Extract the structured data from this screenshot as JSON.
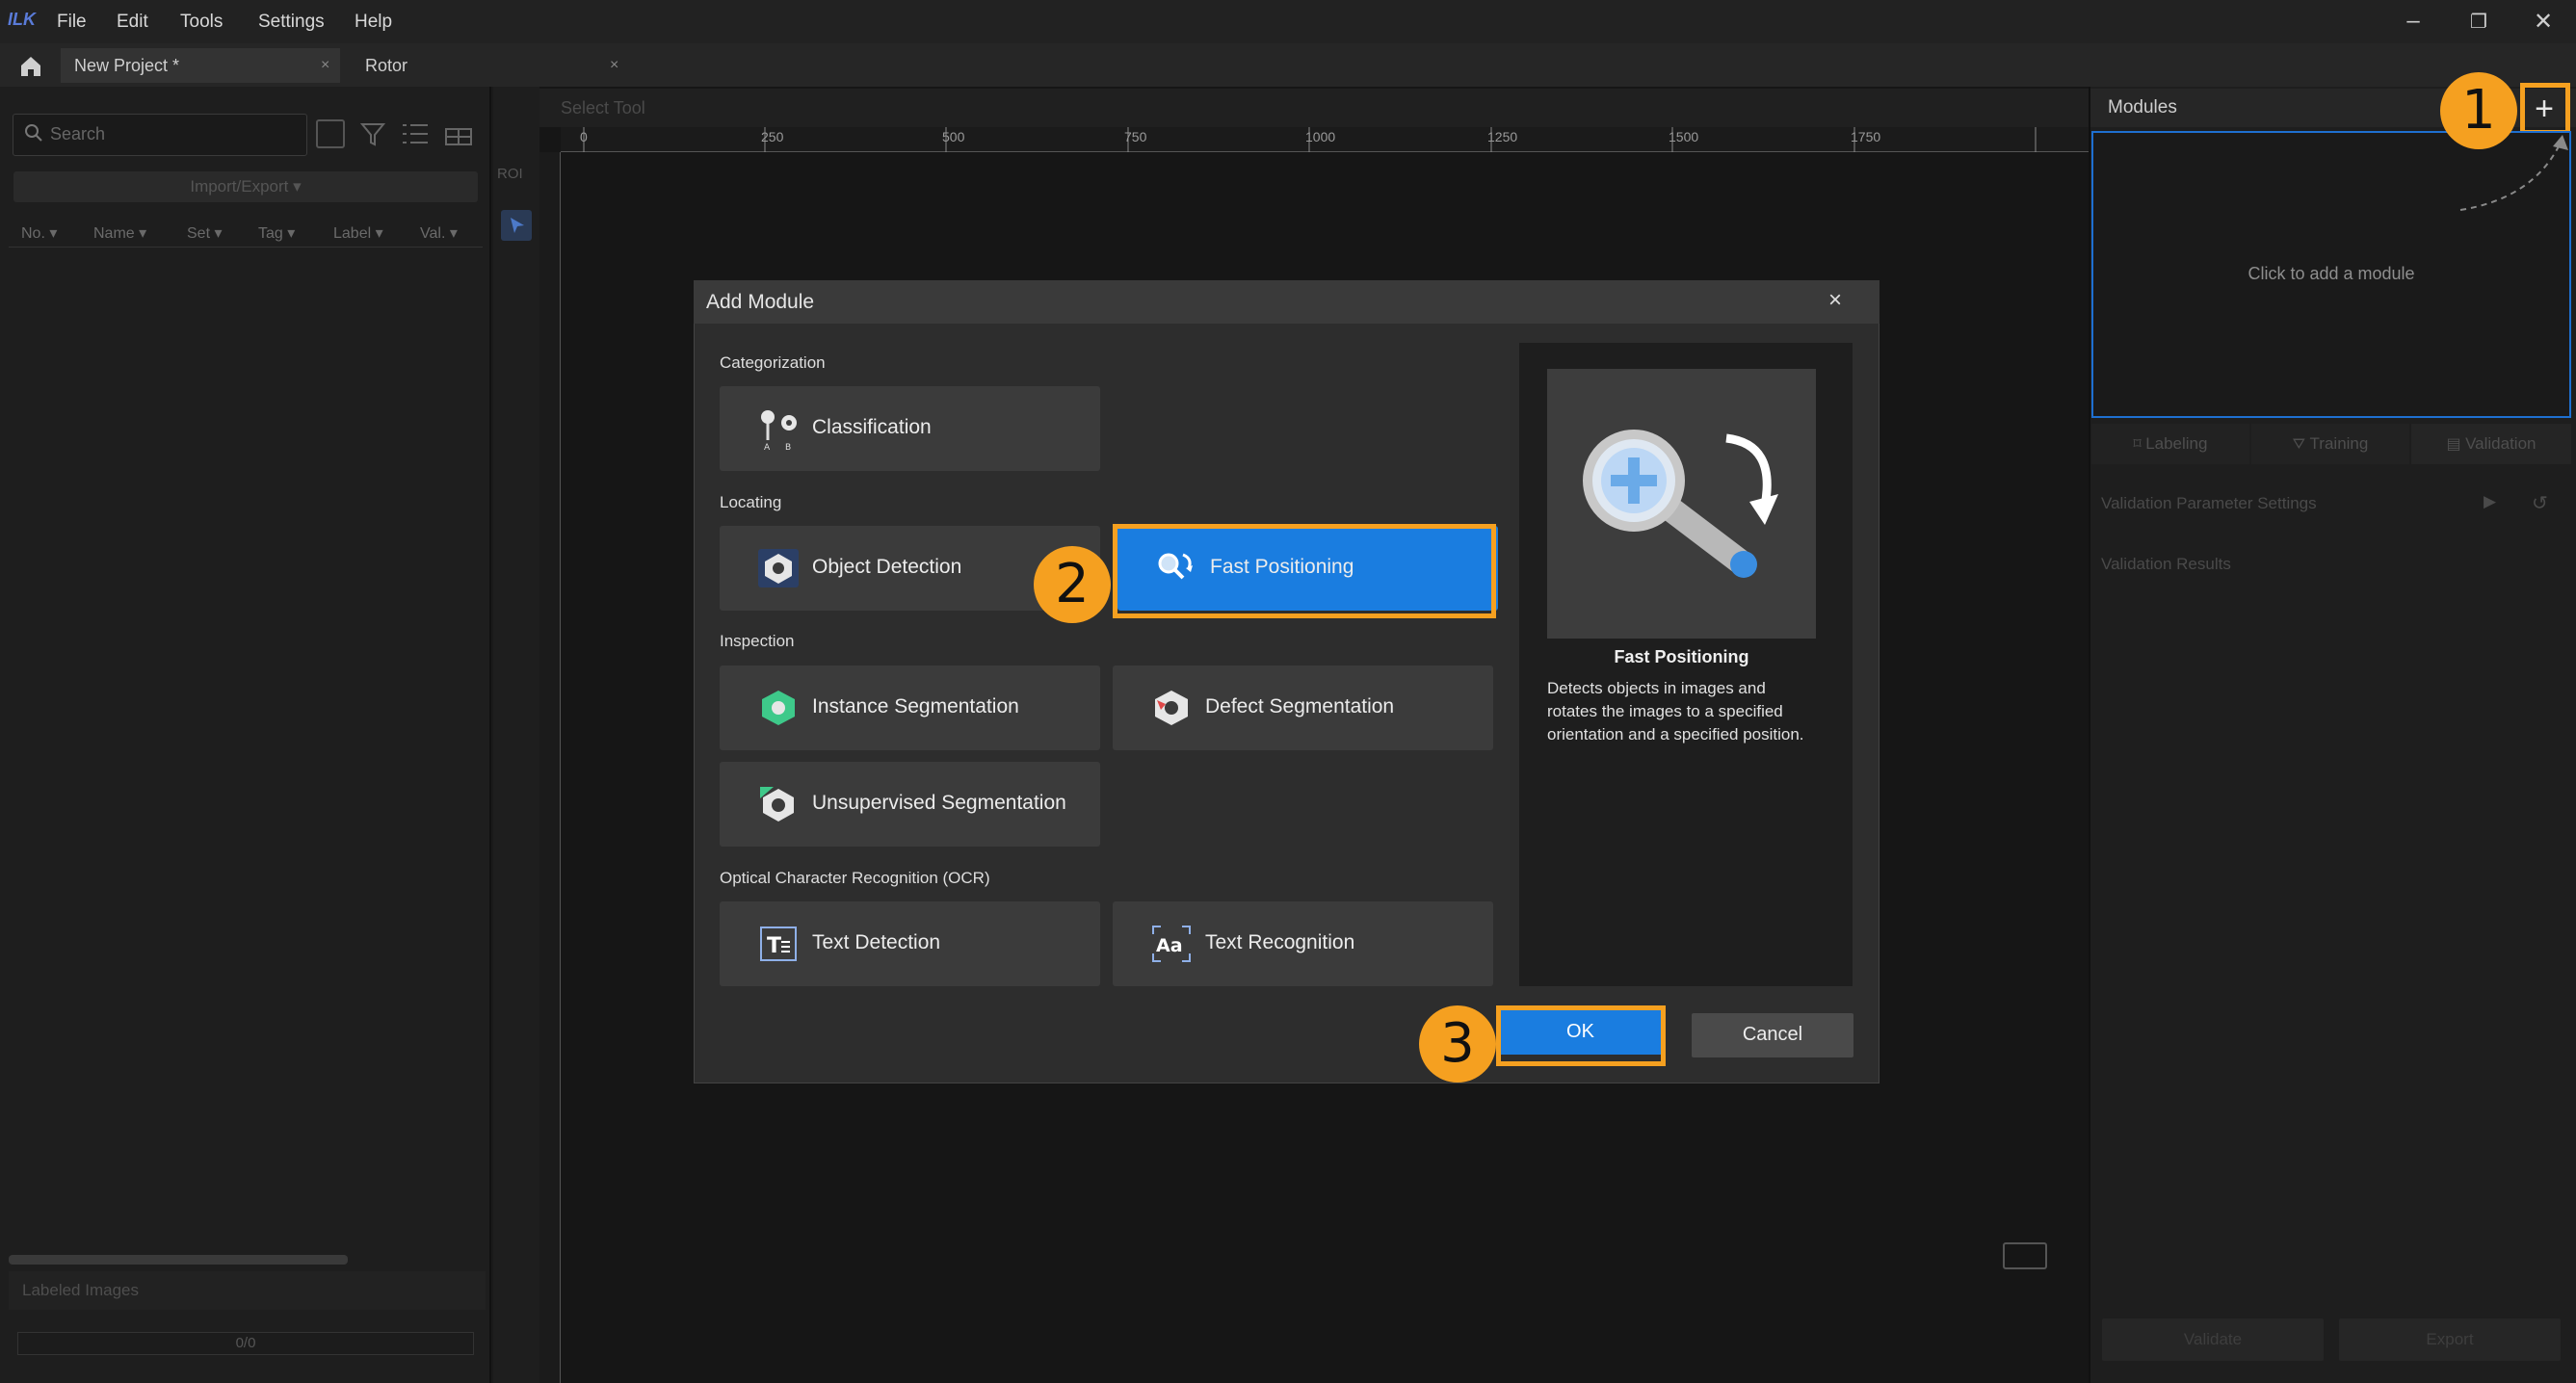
{
  "menubar": {
    "app_logo": "ILK",
    "items": [
      "File",
      "Edit",
      "Tools",
      "Settings",
      "Help"
    ],
    "window_controls": [
      "minimize-icon",
      "restore-icon",
      "close-icon"
    ]
  },
  "tabs": [
    {
      "label": "New Project *",
      "close": "×"
    },
    {
      "label": "Rotor",
      "close": "×"
    }
  ],
  "left_panel": {
    "search_placeholder": "Search",
    "import_export": "Import/Export",
    "columns": [
      "No.",
      "Name",
      "Set",
      "Tag",
      "Label",
      "Val."
    ],
    "labeled_images": "Labeled Images",
    "progress": "0/0"
  },
  "canvas": {
    "select_tool": "Select Tool",
    "ruler_ticks": [
      "0",
      "250",
      "500",
      "750",
      "1000",
      "1250",
      "1500",
      "1750"
    ],
    "roi_label": "ROI"
  },
  "right_panel": {
    "modules_title": "Modules",
    "add_button": "+",
    "empty_hint": "Click to add a module",
    "tabs": [
      "Labeling",
      "Training",
      "Validation"
    ],
    "validation_params": "Validation Parameter Settings",
    "validation_results": "Validation Results",
    "validate_button": "Validate",
    "export_button": "Export"
  },
  "dialog": {
    "title": "Add Module",
    "close": "×",
    "sections": [
      {
        "label": "Categorization",
        "modules": [
          "Classification"
        ]
      },
      {
        "label": "Locating",
        "modules": [
          "Object Detection",
          "Fast Positioning"
        ]
      },
      {
        "label": "Inspection",
        "modules": [
          "Instance Segmentation",
          "Defect Segmentation",
          "Unsupervised Segmentation"
        ]
      },
      {
        "label": "Optical Character Recognition (OCR)",
        "modules": [
          "Text Detection",
          "Text Recognition"
        ]
      }
    ],
    "selected_module": "Fast Positioning",
    "preview": {
      "title": "Fast Positioning",
      "description": "Detects objects in images and rotates the images to a specified orientation and a specified position."
    },
    "ok": "OK",
    "cancel": "Cancel"
  },
  "callouts": [
    "1",
    "2",
    "3"
  ],
  "colors": {
    "accent": "#1a7de0",
    "highlight": "#f5a020",
    "background": "#1a1a1a",
    "dialog": "#2d2d2d"
  }
}
